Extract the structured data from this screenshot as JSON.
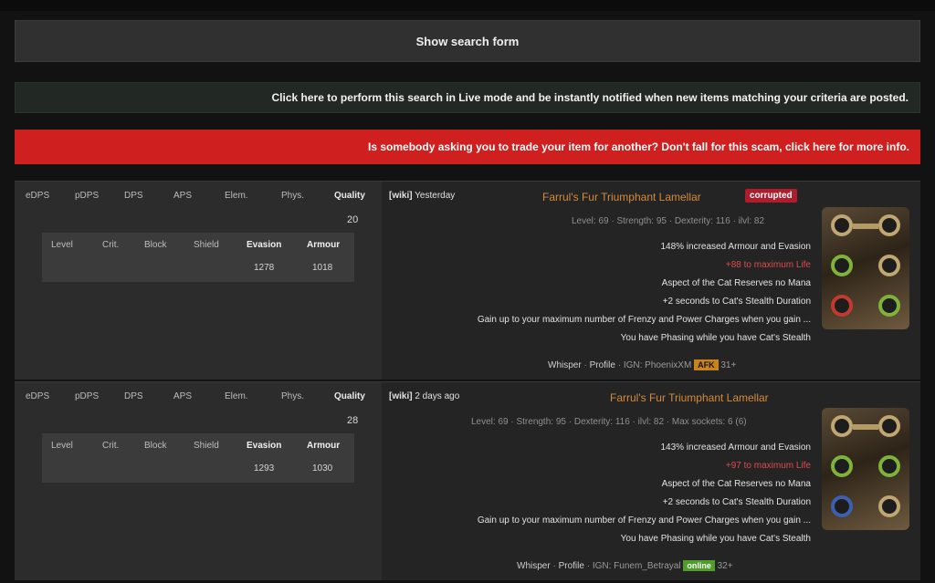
{
  "search_button": "Show search form",
  "live_notice": "Click here to perform this search in Live mode and be instantly notified when new items matching your criteria are posted.",
  "scam_notice": "Is somebody asking you to trade your item for another? Don't fall for this scam, click here for more info.",
  "stat_headers": [
    "Quality",
    "Phys.",
    "Elem.",
    "APS",
    "DPS",
    "pDPS",
    "eDPS"
  ],
  "sub_headers": [
    "Armour",
    "Evasion",
    "Shield",
    "Block",
    "Crit.",
    "Level"
  ],
  "items": [
    {
      "wiki": "[wiki]",
      "posted": "Yesterday",
      "corrupted": "corrupted",
      "name": "Farrul's Fur Triumphant Lamellar",
      "requirements": "Level: 69 · Strength: 95 · Dexterity: 116 · ilvl: 82",
      "quality": "20",
      "armour": "1018",
      "evasion": "1278",
      "mods": [
        "148% increased Armour and Evasion",
        "+88 to maximum Life",
        "Aspect of the Cat Reserves no Mana",
        "+2 seconds to Cat's Stealth Duration",
        "Gain up to your maximum number of Frenzy and Power Charges when you gain ...",
        "You have Phasing while you have Cat's Stealth"
      ],
      "seller": "31+",
      "status": "AFK",
      "ign": "IGN: PhoenixXM",
      "profile": "Profile",
      "whisper": "Whisper"
    },
    {
      "wiki": "[wiki]",
      "posted": "2 days ago",
      "corrupted": "",
      "name": "Farrul's Fur Triumphant Lamellar",
      "requirements": "Level: 69 · Strength: 95 · Dexterity: 116 · ilvl: 82 · Max sockets: 6 (6)",
      "quality": "28",
      "armour": "1030",
      "evasion": "1293",
      "mods": [
        "143% increased Armour and Evasion",
        "+97 to maximum Life",
        "Aspect of the Cat Reserves no Mana",
        "+2 seconds to Cat's Stealth Duration",
        "Gain up to your maximum number of Frenzy and Power Charges when you gain ...",
        "You have Phasing while you have Cat's Stealth"
      ],
      "seller": "32+",
      "status": "online",
      "ign": "IGN: Funem_Betrayal",
      "profile": "Profile",
      "whisper": "Whisper"
    }
  ]
}
